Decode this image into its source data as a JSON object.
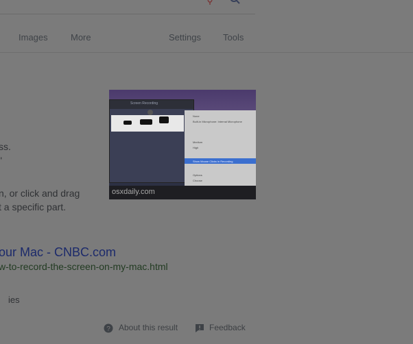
{
  "tabs": {
    "images": "Images",
    "more": "More",
    "settings": "Settings",
    "tools": "Tools"
  },
  "snippet": {
    "line1": "ss.",
    "line2": "\"",
    "line3": "n, or click and drag",
    "line4": "t a specific part."
  },
  "thumbnail": {
    "window_title": "Screen Recording",
    "watermark": "osxdaily.com",
    "menu_rows": [
      "None",
      "Built-in Microphone: Internal Microphone",
      "Medium",
      "High",
      "Show Mouse Clicks in Recording",
      "Options",
      "Choose"
    ]
  },
  "result": {
    "title": "our Mac - CNBC.com",
    "url": "w-to-record-the-screen-on-my-mac.html",
    "extra": "ies"
  },
  "footer": {
    "about": "About this result",
    "feedback": "Feedback"
  },
  "colors": {
    "background": "#7b7b7b",
    "link": "#1c2a6b",
    "url": "#223b22"
  }
}
